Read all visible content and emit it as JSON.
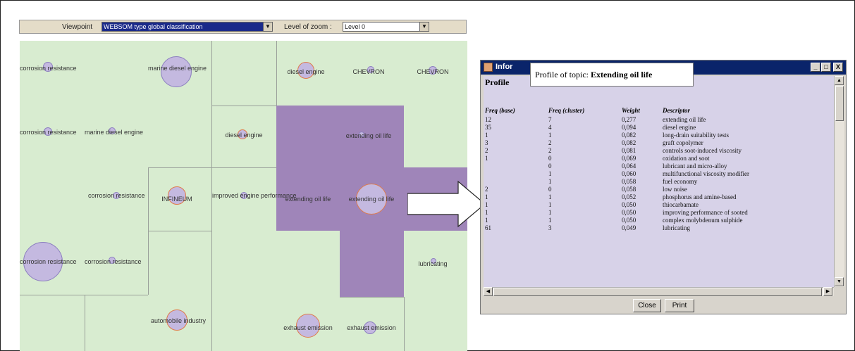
{
  "toolbar": {
    "viewpoint_label": "Viewpoint",
    "viewpoint_value": "WEBSOM type global classification",
    "zoom_label": "Level of zoom :",
    "zoom_value": "Level 0",
    "dropdown_glyph": "▼"
  },
  "map": {
    "labels": {
      "corrosion_resistance": "corrosion resistance",
      "marine_diesel_engine": "marine diesel engine",
      "diesel_engine": "diesel engine",
      "chevron": "CHEVRON",
      "extending_oil_life": "extending oil life",
      "infineum": "INFINEUM",
      "improved_engine_performance": "improved engine performance",
      "lubricating": "lubricating",
      "automobile_industry": "automobile industry",
      "exhaust_emission": "exhaust emission"
    },
    "colors": {
      "background": "#d8ecd0",
      "highlight": "#9f85b9",
      "circle": "#c4b9e0",
      "ring": "#e07a4a"
    }
  },
  "dialog": {
    "title": "Infor",
    "tooltip_prefix": "Profile of topic: ",
    "tooltip_topic": "Extending oil life",
    "section_title": "Profile",
    "columns": [
      "Freq (base)",
      "Freq (cluster)",
      "Weight",
      "Descriptor"
    ],
    "rows": [
      [
        "12",
        "7",
        "0,277",
        "extending oil life"
      ],
      [
        "35",
        "4",
        "0,094",
        "diesel engine"
      ],
      [
        "1",
        "1",
        "0,082",
        "long-drain suitability tests"
      ],
      [
        "3",
        "2",
        "0,082",
        "graft copolymer"
      ],
      [
        "2",
        "2",
        "0,081",
        "controls soot-induced viscosity"
      ],
      [
        "1",
        "0",
        "0,069",
        "oxidation and soot"
      ],
      [
        "",
        "0",
        "0,064",
        "lubricant and micro-alloy"
      ],
      [
        "",
        "1",
        "0,060",
        "multifunctional viscosity modifier"
      ],
      [
        "",
        "1",
        "0,058",
        "fuel economy"
      ],
      [
        "2",
        "0",
        "0,058",
        "low noise"
      ],
      [
        "1",
        "1",
        "0,052",
        "phosphorus and amine-based"
      ],
      [
        "1",
        "1",
        "0,050",
        "thiocarbamate"
      ],
      [
        "1",
        "1",
        "0,050",
        "improving performance of sooted"
      ],
      [
        "1",
        "1",
        "0,050",
        "complex molybdenum sulphide"
      ],
      [
        "61",
        "3",
        "0,049",
        "lubricating"
      ]
    ],
    "buttons": {
      "close": "Close",
      "print": "Print"
    },
    "window_buttons": {
      "minimize": "_",
      "maximize": "□",
      "close": "X"
    }
  }
}
